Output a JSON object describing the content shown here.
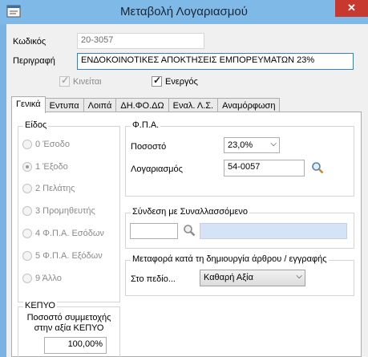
{
  "window": {
    "title": "Μεταβολή Λογαριασμού",
    "close_glyph": "✕",
    "app_icon": "form-icon"
  },
  "fields": {
    "code_label": "Κωδικός",
    "code_value": "20-3057",
    "description_label": "Περιγραφή",
    "description_value": "ΕΝΔΟΚΟΙΝΟΤΙΚΕΣ ΑΠΟΚΤΗΣΕΙΣ ΕΜΠΟΡΕΥΜΑΤΩΝ 23%"
  },
  "checkboxes": {
    "moving_label": "Κινείται",
    "moving_checked": true,
    "active_label": "Ενεργός",
    "active_checked": true
  },
  "tabs": [
    {
      "label": "Γενικά",
      "active": true
    },
    {
      "label": "Εντυπα",
      "active": false
    },
    {
      "label": "Λοιπά",
      "active": false
    },
    {
      "label": "ΔΗ.ΦΟ.ΔΩ",
      "active": false
    },
    {
      "label": "Εναλ. Λ.Σ.",
      "active": false
    },
    {
      "label": "Αναμόρφωση",
      "active": false
    }
  ],
  "type_group": {
    "title": "Είδος",
    "options": [
      {
        "label": "0 Έσοδο",
        "selected": false
      },
      {
        "label": "1 Έξοδο",
        "selected": true
      },
      {
        "label": "2 Πελάτης",
        "selected": false
      },
      {
        "label": "3 Προμηθευτής",
        "selected": false
      },
      {
        "label": "4 Φ.Π.Α. Εσόδων",
        "selected": false
      },
      {
        "label": "5 Φ.Π.Α. Εξόδων",
        "selected": false
      },
      {
        "label": "9 Άλλο",
        "selected": false
      }
    ]
  },
  "vat_group": {
    "title": "Φ.Π.Α.",
    "rate_label": "Ποσοστό",
    "rate_value": "23,0%",
    "account_label": "Λογαριασμός",
    "account_value": "54-0057"
  },
  "link_group": {
    "title": "Σύνδεση με Συναλλασσόμενο",
    "code_value": "",
    "name_value": ""
  },
  "transfer_group": {
    "title": "Μεταφορά κατά τη δημιουργία άρθρου / εγγραφής",
    "field_label": "Στο πεδίο...",
    "field_value": "Καθαρή Αξία"
  },
  "kepyo_group": {
    "title": "ΚΕΠΥΟ",
    "participation_label_line1": "Ποσοστό συμμετοχής",
    "participation_label_line2": "στην αξία ΚΕΠΥΟ",
    "participation_value": "100,00%"
  },
  "colors": {
    "titlebar": "#7fb9e8",
    "close": "#c7382f",
    "link_field": "#d6e3f7"
  }
}
